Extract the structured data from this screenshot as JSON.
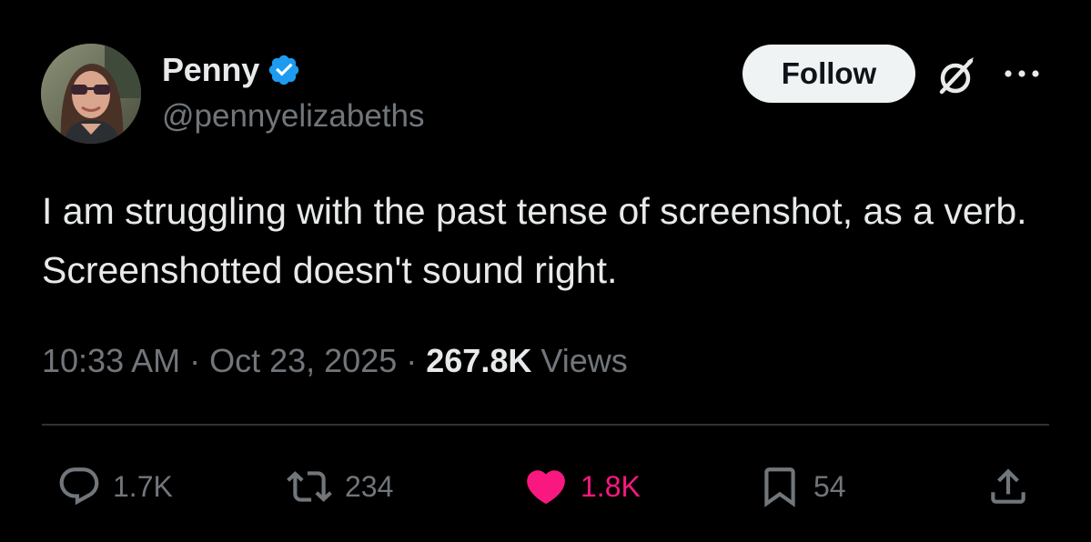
{
  "author": {
    "display_name": "Penny",
    "handle": "@pennyelizabeths",
    "verified": true,
    "verified_color": "#1d9bf0"
  },
  "header": {
    "follow_label": "Follow",
    "grok_icon": "grok-icon",
    "more_icon": "more-icon"
  },
  "tweet": {
    "text": "I am struggling with the past tense of screenshot, as a verb. Screenshotted doesn't sound right."
  },
  "meta": {
    "time": "10:33 AM",
    "separator": "·",
    "date": "Oct 23, 2025",
    "views_count": "267.8K",
    "views_label": "Views"
  },
  "actions": {
    "reply_count": "1.7K",
    "retweet_count": "234",
    "like_count": "1.8K",
    "like_active": true,
    "like_color": "#f91880",
    "bookmark_count": "54"
  },
  "colors": {
    "background": "#000000",
    "text_primary": "#e7e9ea",
    "text_secondary": "#71767b",
    "divider": "#2f3336"
  }
}
